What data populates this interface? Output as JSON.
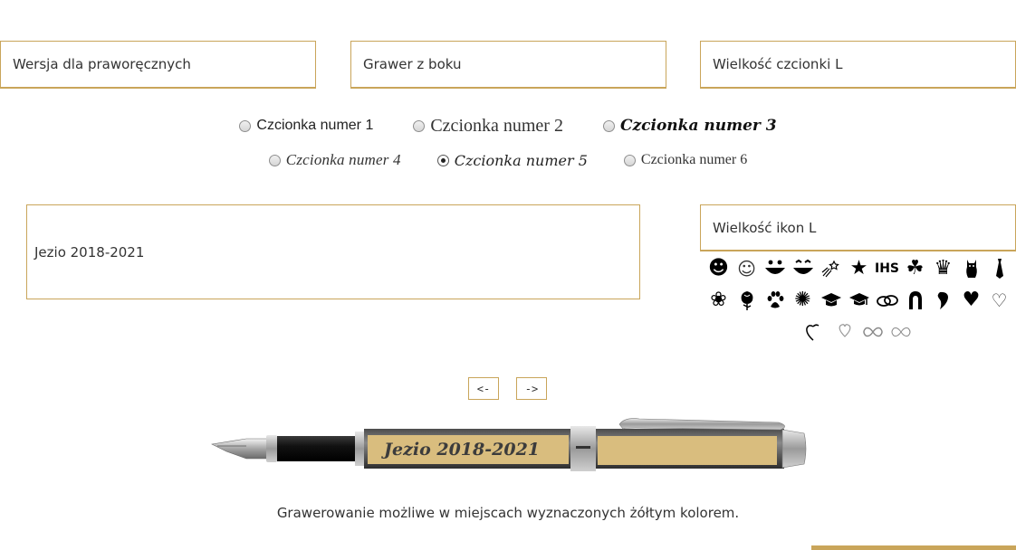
{
  "selects": {
    "handedness": "Wersja dla praworęcznych",
    "engraving_side": "Grawer z boku",
    "font_size": "Wielkość czcionki L",
    "icon_size": "Wielkość ikon L"
  },
  "fonts": {
    "options": [
      "Czcionka numer 1",
      "Czcionka numer 2",
      "Czcionka numer 3",
      "Czcionka numer 4",
      "Czcionka numer 5",
      "Czcionka numer 6"
    ],
    "selected": "Czcionka numer 5"
  },
  "engraving_text": "Jezio 2018-2021",
  "icons": [
    "grinning-face-icon",
    "smiling-face-icon",
    "laughing-face-icon",
    "happy-face-icon",
    "shooting-star-icon",
    "star-icon",
    "ihs-symbol-icon",
    "clover-icon",
    "crown-icon",
    "cat-icon",
    "tie-icon",
    "rose-icon",
    "rose-bud-icon",
    "paw-icon",
    "medal-rosette-icon",
    "graduation-cap-icon",
    "graduation-cap-alt-icon",
    "wedding-rings-icon",
    "horseshoe-icon",
    "heart-broken-half-icon",
    "heart-icon",
    "heart-outline-icon",
    "two-hearts-icon",
    "two-hearts-outline-icon",
    "infinity-icon",
    "infinity-outline-icon"
  ],
  "icon_labels": {
    "ihs": "IHS"
  },
  "nav": {
    "prev": "<-",
    "next": "->"
  },
  "preview": {
    "engraved_text": "Jezio 2018-2021"
  },
  "notice": "Grawerowanie możliwe w miejscach wyznaczonych żółtym kolorem.",
  "colors": {
    "accent_gold": "#c9a55a",
    "engraving_area": "#d9bd7e"
  }
}
